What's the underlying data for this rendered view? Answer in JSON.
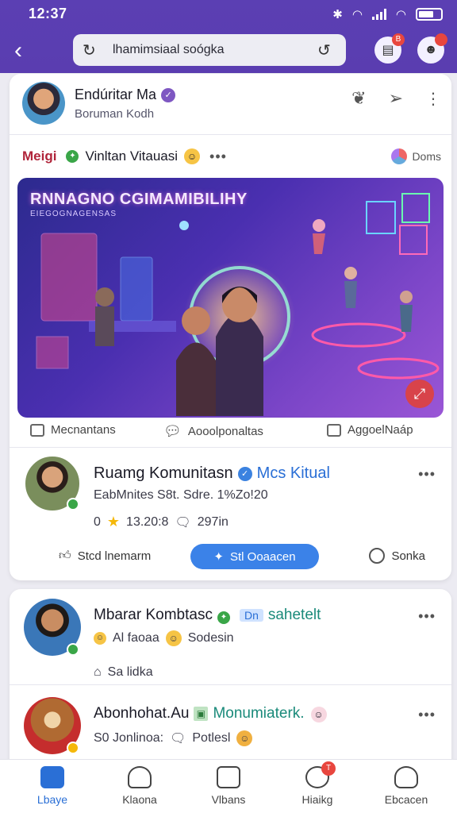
{
  "status_bar": {
    "time": "12:37"
  },
  "browser": {
    "url": "lhamimsiaal soógka",
    "back_icon": "back-arrow-icon",
    "reload_icon": "reload-icon"
  },
  "toolbar": {
    "notif_badge": "B"
  },
  "profile": {
    "name": "Endúritar Ma",
    "subtitle": "Boruman Kodh"
  },
  "group": {
    "left_label": "Meigi",
    "name": "Vinltan Vitauasi",
    "right_label": "Doms"
  },
  "hero": {
    "title": "RNNAGNO CGIMAMIBILIHY",
    "subtitle": "EIEGOGNAGENSAS"
  },
  "tabs": [
    {
      "label": "Mecnantans"
    },
    {
      "label": "Aooolponaltas"
    },
    {
      "label": "AggoelNaáp"
    }
  ],
  "community_post": {
    "name": "Ruamg Komunitasn",
    "name_suffix": "Mcs Kitual",
    "meta": "EabMnites S8t. Sdre. 1%Zo!20",
    "rating_prefix": "0",
    "rating": "13.20:8",
    "comments": "297in",
    "btn_outline": "Stcd lnemarm",
    "btn_primary": "Stl Ooaacen",
    "btn_save": "Sonka"
  },
  "feed": [
    {
      "name": "Mbarar Kombtasc",
      "tag": "Dn",
      "suffix": "sahetelt",
      "line1": "Al faoaa",
      "line1b": "Sodesin",
      "line2": "Sa lidka"
    },
    {
      "name": "Abonhohat.Au",
      "suffix": "Monumiaterk.",
      "line1": "S0 Jonlinoa:",
      "line1b": "Potlesl"
    }
  ],
  "bottom_nav": [
    {
      "label": "Lbaye",
      "icon": "home-icon",
      "active": true
    },
    {
      "label": "Klaona",
      "icon": "community-icon"
    },
    {
      "label": "Vlbans",
      "icon": "box-icon"
    },
    {
      "label": "Hiaikg",
      "icon": "chat-icon",
      "badge": "T"
    },
    {
      "label": "Ebcacen",
      "icon": "profile-icon"
    }
  ],
  "colors": {
    "header": "#5b3fb3",
    "primary": "#3b82e8",
    "accent_red": "#e8463e"
  }
}
